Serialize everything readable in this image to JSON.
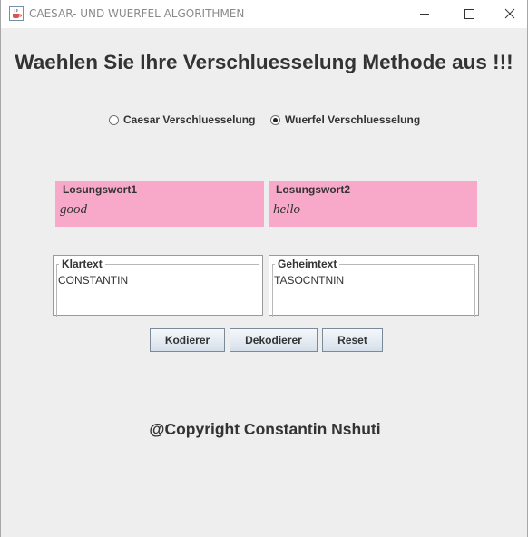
{
  "window": {
    "title": "CAESAR- UND WUERFEL ALGORITHMEN",
    "icon": "java-cup-icon",
    "controls": [
      "minimize-icon",
      "maximize-icon",
      "close-icon"
    ]
  },
  "heading": "Waehlen Sie Ihre Verschluesselung Methode aus !!!",
  "methods": [
    {
      "label": "Caesar Verschluesselung",
      "selected": false
    },
    {
      "label": "Wuerfel Verschluesselung",
      "selected": true
    }
  ],
  "keys": {
    "key1": {
      "label": "Losungswort1",
      "value": "good"
    },
    "key2": {
      "label": "Losungswort2",
      "value": "hello"
    },
    "panel_color": "#f8a9c9"
  },
  "plaintext": {
    "label": "Klartext",
    "value": "CONSTANTIN"
  },
  "ciphertext": {
    "label": "Geheimtext",
    "value": "TASOCNTNIN"
  },
  "buttons": {
    "encode": "Kodierer",
    "decode": "Dekodierer",
    "reset": "Reset"
  },
  "footer": "@Copyright Constantin Nshuti"
}
